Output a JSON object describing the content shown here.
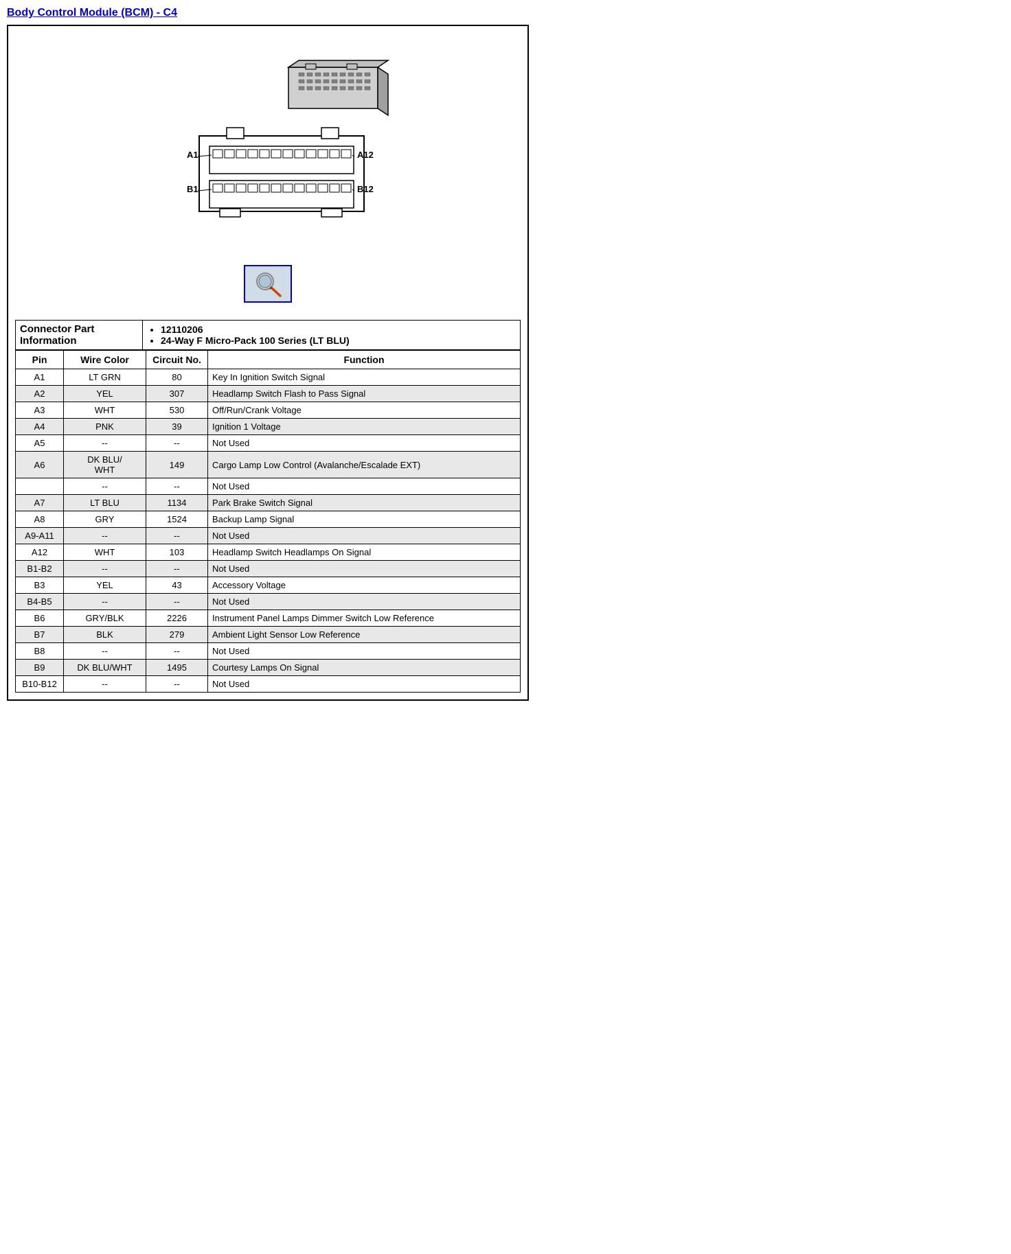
{
  "title": "Body Control Module (BCM) - C4",
  "connector_part_label": "Connector Part Information",
  "connector_parts": [
    "12110206",
    "24-Way F Micro-Pack 100 Series (LT BLU)"
  ],
  "diagram_labels": {
    "a1": "A1",
    "a12": "A12",
    "b1": "B1",
    "b12": "B12"
  },
  "table_headers": {
    "pin": "Pin",
    "wire_color": "Wire Color",
    "circuit_no": "Circuit No.",
    "function": "Function"
  },
  "rows": [
    {
      "pin": "A1",
      "wire": "LT GRN",
      "circuit": "80",
      "function": "Key In Ignition Switch Signal"
    },
    {
      "pin": "A2",
      "wire": "YEL",
      "circuit": "307",
      "function": "Headlamp Switch Flash to Pass Signal"
    },
    {
      "pin": "A3",
      "wire": "WHT",
      "circuit": "530",
      "function": "Off/Run/Crank Voltage"
    },
    {
      "pin": "A4",
      "wire": "PNK",
      "circuit": "39",
      "function": "Ignition 1 Voltage"
    },
    {
      "pin": "A5",
      "wire": "--",
      "circuit": "--",
      "function": "Not Used"
    },
    {
      "pin": "A6",
      "wire": "DK BLU/\nWHT",
      "circuit": "149",
      "function": "Cargo Lamp Low Control (Avalanche/Escalade EXT)"
    },
    {
      "pin": "",
      "wire": "--",
      "circuit": "--",
      "function": "Not Used"
    },
    {
      "pin": "A7",
      "wire": "LT BLU",
      "circuit": "1134",
      "function": "Park Brake Switch Signal"
    },
    {
      "pin": "A8",
      "wire": "GRY",
      "circuit": "1524",
      "function": "Backup Lamp Signal"
    },
    {
      "pin": "A9-A11",
      "wire": "--",
      "circuit": "--",
      "function": "Not Used"
    },
    {
      "pin": "A12",
      "wire": "WHT",
      "circuit": "103",
      "function": "Headlamp Switch Headlamps On Signal"
    },
    {
      "pin": "B1-B2",
      "wire": "--",
      "circuit": "--",
      "function": "Not Used"
    },
    {
      "pin": "B3",
      "wire": "YEL",
      "circuit": "43",
      "function": "Accessory Voltage"
    },
    {
      "pin": "B4-B5",
      "wire": "--",
      "circuit": "--",
      "function": "Not Used"
    },
    {
      "pin": "B6",
      "wire": "GRY/BLK",
      "circuit": "2226",
      "function": "Instrument Panel Lamps Dimmer Switch Low Reference"
    },
    {
      "pin": "B7",
      "wire": "BLK",
      "circuit": "279",
      "function": "Ambient Light Sensor Low Reference"
    },
    {
      "pin": "B8",
      "wire": "--",
      "circuit": "--",
      "function": "Not Used"
    },
    {
      "pin": "B9",
      "wire": "DK BLU/WHT",
      "circuit": "1495",
      "function": "Courtesy Lamps On Signal"
    },
    {
      "pin": "B10-B12",
      "wire": "--",
      "circuit": "--",
      "function": "Not Used"
    }
  ]
}
